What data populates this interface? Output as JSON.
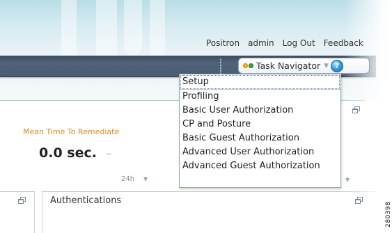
{
  "top_nav": {
    "product": "Positron",
    "user": "admin",
    "logout": "Log Out",
    "feedback": "Feedback"
  },
  "task_navigator": {
    "label": "Task Navigator",
    "icon": "glasses-icon",
    "help_icon": "help-icon"
  },
  "menu": {
    "items": [
      "Setup",
      "Profiling",
      "Basic User Authorization",
      "CP and Posture",
      "Basic Guest Authorization",
      "Advanced User Authorization",
      "Advanced Guest Authorization"
    ],
    "selected": "Setup"
  },
  "dashboard": {
    "mttr": {
      "label": "Mean Time To Remediate",
      "value": "0.0 sec.",
      "trend": "–"
    },
    "time_range": "24h",
    "auth_panel_title": "Authentications"
  },
  "colors": {
    "navbar": "#4a5c72",
    "accent_orange": "#e08a1e",
    "header_top": "#b6dbe5"
  },
  "watermark": "280398"
}
